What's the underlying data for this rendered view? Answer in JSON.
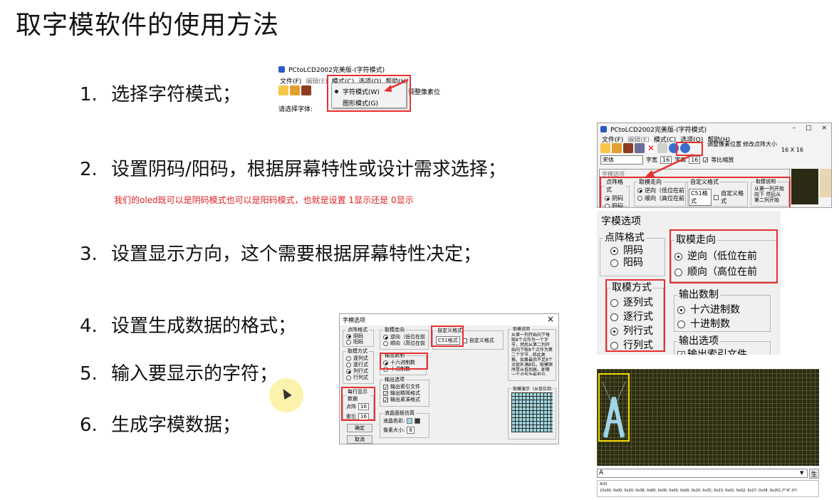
{
  "title": "取字模软件的使用方法",
  "steps": [
    {
      "num": "1.",
      "text": "选择字符模式；"
    },
    {
      "num": "2.",
      "text": "设置阴码/阳码，根据屏幕特性或设计需求选择；"
    },
    {
      "num": "3.",
      "text": "设置显示方向，这个需要根据屏幕特性决定；"
    },
    {
      "num": "4.",
      "text": "设置生成数据的格式；"
    },
    {
      "num": "5.",
      "text": "输入要显示的字符；"
    },
    {
      "num": "6.",
      "text": "生成字模数据；"
    }
  ],
  "note": "我们的oled既可以是阴码模式也可以是阳码模式，也就是设置 1显示还是 0显示",
  "shot1": {
    "app_title": "PCtoLCD2002完美版-(字符模式)",
    "menu": [
      "文件(F)",
      "编辑(E)",
      "模式(C)",
      "选项(O)",
      "帮助(H)"
    ],
    "dropdown": [
      "字符模式(W)",
      "图形模式(G)"
    ],
    "right_text": "调整像素位",
    "font_label": "请选择字体:"
  },
  "shot2": {
    "app_title": "PCtoLCD2002完美版-(字符模式)",
    "menu": [
      "文件(F)",
      "编辑(E)",
      "模式(C)",
      "选项(O)",
      "帮助(H)"
    ],
    "window_controls": [
      "–",
      "□",
      "×"
    ],
    "adjust_label": "调整像素位置",
    "resize_label": "修改点阵大小",
    "size_value": "16 X 16",
    "font_combo": "宋体",
    "w_label": "字宽",
    "w_value": "16",
    "h_label": "字高",
    "h_value": "16",
    "scale_label": "等比缩放",
    "dialog_title": "字模选项",
    "dot_group": "点阵格式",
    "dot_opts": [
      "阴码",
      "阳码"
    ],
    "dir_group": "取模走向",
    "dir_opts": [
      "逆向（低位在前",
      "顺向（高位在前"
    ],
    "custom_group": "自定义格式",
    "custom_value": "C51格式",
    "custom_label": "自定义格式",
    "desc_group": "取模说明",
    "desc_text": "从第一列开始向下 然后从第二列开始"
  },
  "shot3": {
    "title": "字模选项",
    "dot_group": "点阵格式",
    "dot_opts": [
      "阴码",
      "阳码"
    ],
    "dir_group": "取模走向",
    "dir_opts": [
      "逆向（低位在前",
      "顺向（高位在前"
    ],
    "mode_group": "取模方式",
    "mode_opts": [
      "逐列式",
      "逐行式",
      "列行式",
      "行列式"
    ],
    "out_group": "输出数制",
    "out_opts": [
      "十六进制数",
      "十进制数"
    ],
    "outopt_group": "输出选项",
    "outopt_first": "输出索引文件"
  },
  "shot4": {
    "title": "字模选项",
    "close": "×",
    "dot_group": "点阵格式",
    "dot_opts": [
      "阴码",
      "阳码"
    ],
    "dir_group": "取模走向",
    "dir_opts": [
      "逆向（低位在前",
      "顺向（高位在前"
    ],
    "custom_group": "自定义格式",
    "custom_value": "C51格式",
    "custom_label": "自定义格式",
    "desc_group": "取模说明",
    "desc_text": "从第一列开始向下每取8个点作为一个字节，然后从第二列开始向下取8个点作为第二个字节...依此类推。如果最后不足8个点就补满8位。取模顺序是从低到高，即第一个点作为最低位。",
    "mode_group": "取模方式",
    "mode_opts": [
      "逐列式",
      "逐行式",
      "列行式",
      "行列式"
    ],
    "out_group": "输出数制",
    "out_opts": [
      "十六进制数",
      "十进制数"
    ],
    "outopt_group": "输出选项",
    "outopt_opts": [
      "输出索引文件",
      "输出精简格式",
      "输出紧凑格式"
    ],
    "per_row_group": "每行显示数据",
    "dots_label": "点阵",
    "dots_value": "16",
    "index_label": "索引",
    "index_value": "16",
    "lcd_group": "液晶面板仿真",
    "lcd_color_label": "液晶色彩:",
    "pixel_label": "像素大小:",
    "pixel_value": "8",
    "preview_group": "取模演示（从低位到",
    "btn_ok": "确定",
    "btn_cancel": "取消"
  },
  "shot5": {
    "input_value": "A",
    "gen_button": "生",
    "output_line1": "A(0)",
    "output_line2": "{0x00, 0x00, 0x20, 0x38, 0x80, 0x00, 0x00, 0x00, 0x20, 0x3C, 0x23, 0x02, 0x02, 0x27, 0x38, 0x20},/*\"A\",0*/"
  },
  "colors": {
    "note_red": "#e02020",
    "highlight_red": "#e53030",
    "lcd_bg": "#2b2b15",
    "lcd_on": "#9fd6ea",
    "select_frame": "#f0d800"
  }
}
